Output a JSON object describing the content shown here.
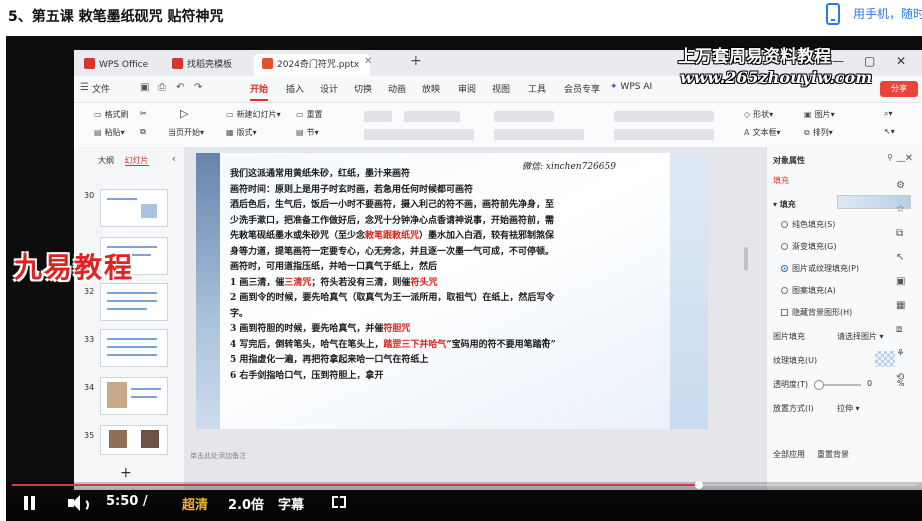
{
  "page": {
    "title": "5、第五课 敕笔墨纸砚咒 贴符神咒",
    "phone_link": "用手机，随时"
  },
  "wps": {
    "tabs": [
      {
        "label": "WPS Office",
        "icon_color": "#d9342b"
      },
      {
        "label": "找稻壳模板",
        "icon_color": "#d9342b"
      },
      {
        "label": "2024奇门符咒.pptx",
        "icon_color": "#e0502a"
      }
    ],
    "tab_plus": "+",
    "window_controls": [
      "▭",
      "—",
      "▢",
      "✕"
    ],
    "menu": {
      "file": "文件",
      "items": [
        "开始",
        "插入",
        "设计",
        "切换",
        "动画",
        "放映",
        "审阅",
        "视图",
        "工具",
        "会员专享"
      ],
      "active": "开始",
      "wps_ai": "WPS AI",
      "share": "分享"
    },
    "ribbon": {
      "format_painter": "格式刷",
      "paste": "粘贴",
      "from_current": "当页开始",
      "new_slide": "新建幻灯片",
      "layout": "版式",
      "section": "节",
      "reset": "重置",
      "shape": "形状",
      "image": "图片",
      "textbox": "文本框",
      "arrange": "排列"
    },
    "left_panel": {
      "tab_outline": "大纲",
      "tab_slides": "幻灯片",
      "collapse": "‹",
      "thumbs": [
        "30",
        "31",
        "32",
        "33",
        "34",
        "35"
      ],
      "add": "+"
    },
    "slide": {
      "wechat": "微信: xinchen726659",
      "lines": [
        [
          {
            "t": "我们这派通常用黄纸朱砂，红纸，墨汁来画符"
          }
        ],
        [
          {
            "t": "画符时间：原则上是用子时玄时画，若急用任何时候都可画符"
          }
        ],
        [
          {
            "t": "酒后色后，生气后，饭后一小时不要画符，摄入利己的符不画，画符前先净身，至"
          }
        ],
        [
          {
            "t": "少洗手漱口，把准备工作做好后，念咒十分钟净心点香请神说事，开始画符前，需"
          }
        ],
        [
          {
            "t": "先敕笔砚纸墨水或朱砂咒（至少念"
          },
          {
            "t": "敕笔跟敕纸咒",
            "r": true
          },
          {
            "t": "）墨水加入白酒，较有祛邪制煞保"
          }
        ],
        [
          {
            "t": "身等力道，提笔画符一定要专心，心无旁念，并且逐一次墨一气可成，不可停顿。"
          }
        ],
        [
          {
            "t": "画符时，可用道指压纸，并哈一口真气于纸上，然后"
          }
        ],
        [
          {
            "t": "1 画三清，催"
          },
          {
            "t": "三清咒",
            "r": true
          },
          {
            "t": "；符头若没有三清，则催"
          },
          {
            "t": "符头咒",
            "r": true
          }
        ],
        [
          {
            "t": "2 画到令的时候，要先哈真气（取真气为王一派所用，取祖气）在纸上，然后写令"
          }
        ],
        [
          {
            "t": "字。"
          }
        ],
        [
          {
            "t": "3 画到符胆的时候，要先哈真气，并催"
          },
          {
            "t": "符胆咒",
            "r": true
          }
        ],
        [
          {
            "t": "4 写完后，倒转笔头，哈气在笔头上，"
          },
          {
            "t": "踏罡三下并哈气",
            "r": true
          },
          {
            "t": "“宝码用的符不要用笔踏符”"
          }
        ],
        [
          {
            "t": "5 用指虚化一遍，再把符拿起来哈一口气在符纸上"
          }
        ],
        [
          {
            "t": "6 右手剑指哈口气，压到符胆上，拿开"
          }
        ]
      ],
      "notes_placeholder": "单击此处添加备注"
    },
    "right_panel": {
      "title": "对象属性",
      "tab": "填充",
      "fill_label": "▾ 填充",
      "options": [
        "纯色填充(S)",
        "渐变填充(G)",
        "图片或纹理填充(P)",
        "图案填充(A)"
      ],
      "selected_option": "图片或纹理填充(P)",
      "hide_bg": "隐藏背景图形(H)",
      "picture_fill_label": "图片填充",
      "picture_fill_value": "请选择图片",
      "texture_label": "纹理填充(U)",
      "transparency_label": "透明度(T)",
      "transparency_value": "0",
      "transparency_unit": "%",
      "placement_label": "放置方式(I)",
      "placement_value": "拉伸",
      "apply_all": "全部应用",
      "reset_bg": "重置背景"
    }
  },
  "watermarks": {
    "line1": "上万套周易资料教程",
    "line2": "www.265zhouyiw.com",
    "brand": "九易教程"
  },
  "player": {
    "time": "5:50 / ",
    "quality": "超清",
    "speed": "2.0倍",
    "subtitle": "字幕",
    "progress": 0.76
  }
}
